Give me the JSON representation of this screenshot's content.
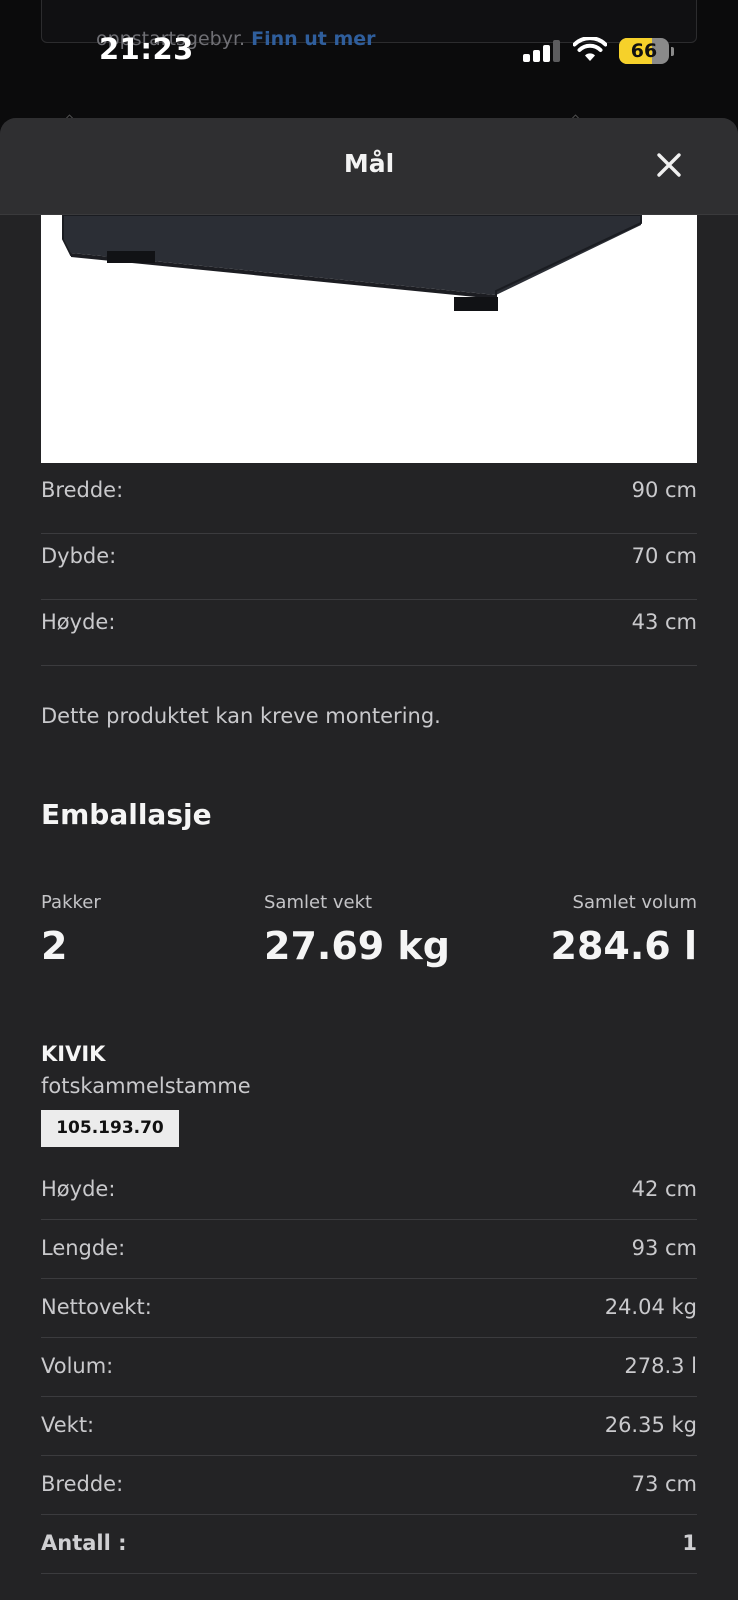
{
  "background": {
    "banner_text": "oppstartsgebyr.",
    "banner_link": "Finn ut mer"
  },
  "status_bar": {
    "time": "21:23",
    "battery": "66",
    "battery_level": 0.66
  },
  "sheet": {
    "title": "Mål",
    "close_icon": "close-icon"
  },
  "dimensions": [
    {
      "label": "Bredde:",
      "value": "90 cm"
    },
    {
      "label": "Dybde:",
      "value": "70 cm"
    },
    {
      "label": "Høyde:",
      "value": "43 cm"
    }
  ],
  "assembly_note": "Dette produktet kan kreve montering.",
  "packaging": {
    "title": "Emballasje",
    "packages_label": "Pakker",
    "packages_value": "2",
    "weight_label": "Samlet vekt",
    "weight_value": "27.69 kg",
    "volume_label": "Samlet volum",
    "volume_value": "284.6 l"
  },
  "package_item": {
    "name": "KIVIK",
    "description": "fotskammelstamme",
    "article_number": "105.193.70",
    "rows": [
      {
        "label": "Høyde:",
        "value": "42 cm"
      },
      {
        "label": "Lengde:",
        "value": "93 cm"
      },
      {
        "label": "Nettovekt:",
        "value": "24.04 kg"
      },
      {
        "label": "Volum:",
        "value": "278.3 l"
      },
      {
        "label": "Vekt:",
        "value": "26.35 kg"
      },
      {
        "label": "Bredde:",
        "value": "73 cm"
      },
      {
        "label": "Antall :",
        "value": "1"
      }
    ]
  }
}
